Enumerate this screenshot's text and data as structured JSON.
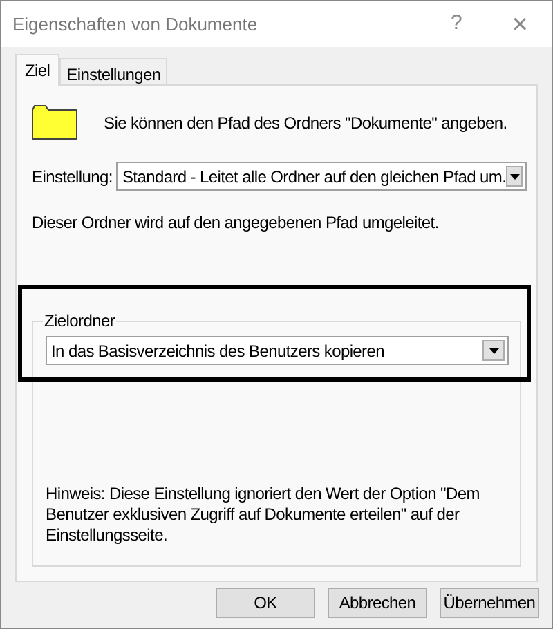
{
  "window": {
    "title": "Eigenschaften von Dokumente",
    "help": "?",
    "close": "×"
  },
  "tabs": [
    {
      "label": "Ziel",
      "selected": true
    },
    {
      "label": "Einstellungen",
      "selected": false
    }
  ],
  "intro": "Sie können den Pfad des Ordners \"Dokumente\" angeben.",
  "setting": {
    "label": "Einstellung:",
    "value": "Standard - Leitet alle Ordner auf den gleichen Pfad um."
  },
  "description": "Dieser Ordner wird auf den angegebenen Pfad umgeleitet.",
  "target_group": {
    "legend": "Zielordner",
    "value": "In das Basisverzeichnis des Benutzers kopieren",
    "highlighted": true,
    "note": "Hinweis: Diese Einstellung ignoriert den Wert der Option \"Dem Benutzer exklusiven Zugriff auf Dokumente erteilen\" auf der Einstellungsseite."
  },
  "buttons": [
    "OK",
    "Abbrechen",
    "Übernehmen"
  ]
}
